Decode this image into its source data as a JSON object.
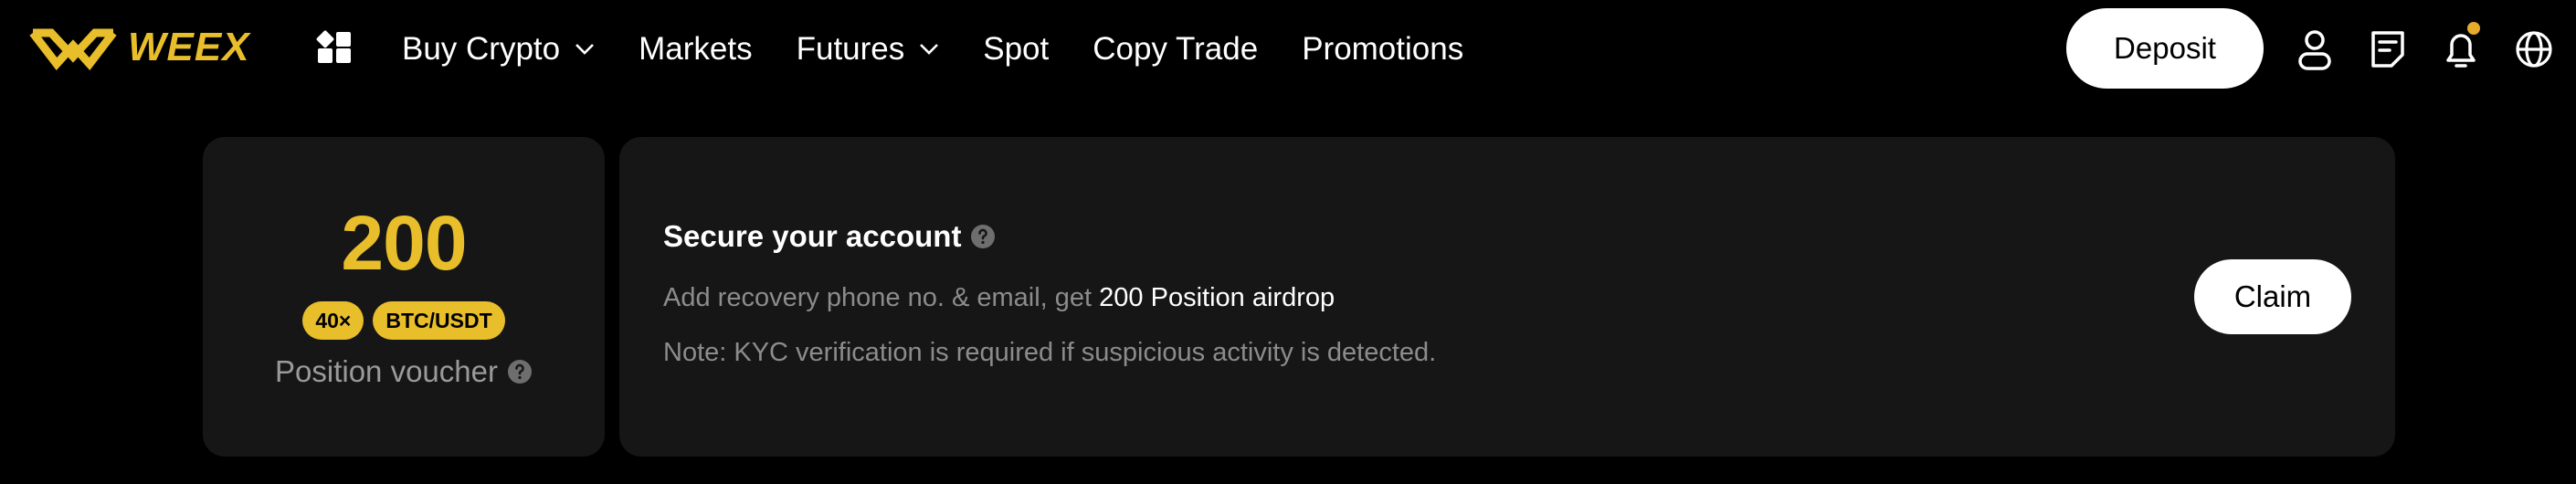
{
  "header": {
    "logo_text": "WEEX",
    "nav": [
      {
        "label": "Buy Crypto",
        "has_dropdown": true
      },
      {
        "label": "Markets",
        "has_dropdown": false
      },
      {
        "label": "Futures",
        "has_dropdown": true
      },
      {
        "label": "Spot",
        "has_dropdown": false
      },
      {
        "label": "Copy Trade",
        "has_dropdown": false
      },
      {
        "label": "Promotions",
        "has_dropdown": false
      }
    ],
    "deposit_label": "Deposit",
    "icons": [
      "apps-icon",
      "user-icon",
      "orders-icon",
      "bell-icon",
      "globe-icon"
    ]
  },
  "voucher": {
    "amount": "200",
    "leverage": "40×",
    "pair": "BTC/USDT",
    "label": "Position voucher"
  },
  "task": {
    "title": "Secure your account",
    "desc_prefix": "Add recovery phone no. & email, get ",
    "desc_highlight": "200 Position airdrop",
    "note": "Note: KYC verification is required if suspicious activity is detected.",
    "claim_label": "Claim"
  },
  "colors": {
    "brand": "#E9BE2B",
    "background": "#000000",
    "card": "#161616",
    "muted_text": "#8C8C8C",
    "notification_dot": "#E9A92B"
  }
}
